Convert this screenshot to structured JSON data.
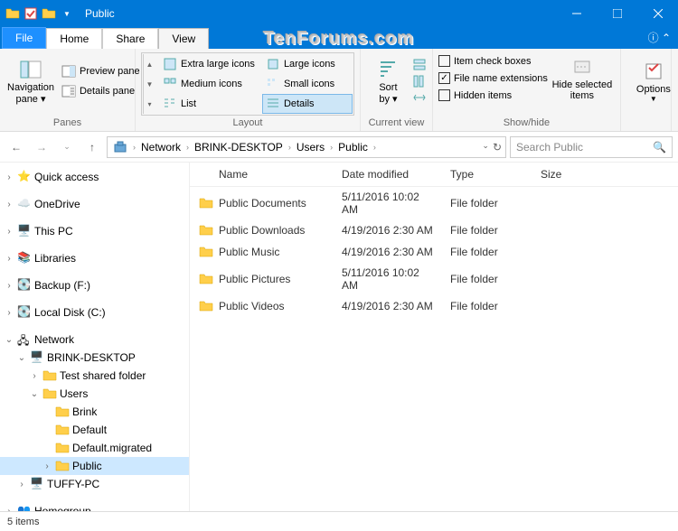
{
  "window": {
    "title": "Public"
  },
  "tabs": {
    "file": "File",
    "home": "Home",
    "share": "Share",
    "view": "View"
  },
  "ribbon": {
    "panes": {
      "label": "Panes",
      "nav": "Navigation\npane ▾",
      "preview": "Preview pane",
      "details": "Details pane"
    },
    "layout": {
      "label": "Layout",
      "xl": "Extra large icons",
      "lg": "Large icons",
      "med": "Medium icons",
      "sm": "Small icons",
      "list": "List",
      "det": "Details"
    },
    "current": {
      "label": "Current view",
      "sort": "Sort\nby ▾"
    },
    "show": {
      "label": "Show/hide",
      "check": "Item check boxes",
      "ext": "File name extensions",
      "hidden": "Hidden items",
      "hidesel": "Hide selected\nitems"
    },
    "options": "Options"
  },
  "breadcrumb": [
    "Network",
    "BRINK-DESKTOP",
    "Users",
    "Public"
  ],
  "search": {
    "placeholder": "Search Public"
  },
  "columns": {
    "name": "Name",
    "date": "Date modified",
    "type": "Type",
    "size": "Size"
  },
  "files": [
    {
      "name": "Public Documents",
      "date": "5/11/2016 10:02 AM",
      "type": "File folder"
    },
    {
      "name": "Public Downloads",
      "date": "4/19/2016 2:30 AM",
      "type": "File folder"
    },
    {
      "name": "Public Music",
      "date": "4/19/2016 2:30 AM",
      "type": "File folder"
    },
    {
      "name": "Public Pictures",
      "date": "5/11/2016 10:02 AM",
      "type": "File folder"
    },
    {
      "name": "Public Videos",
      "date": "4/19/2016 2:30 AM",
      "type": "File folder"
    }
  ],
  "tree": {
    "quick": "Quick access",
    "onedrive": "OneDrive",
    "thispc": "This PC",
    "libraries": "Libraries",
    "backup": "Backup (F:)",
    "local": "Local Disk (C:)",
    "network": "Network",
    "brink": "BRINK-DESKTOP",
    "test": "Test shared folder",
    "users": "Users",
    "u_brink": "Brink",
    "u_default": "Default",
    "u_defmig": "Default.migrated",
    "u_public": "Public",
    "tuffy": "TUFFY-PC",
    "homegroup": "Homegroup"
  },
  "status": "5 items",
  "watermark": "TenForums.com"
}
